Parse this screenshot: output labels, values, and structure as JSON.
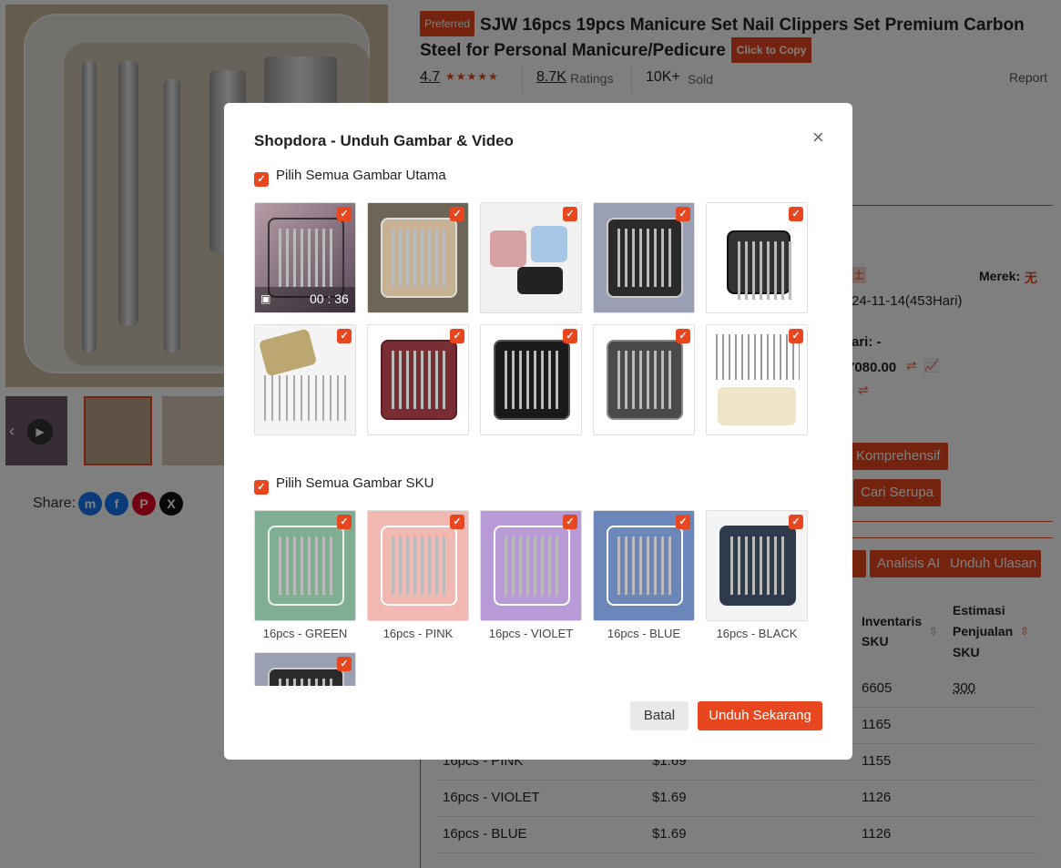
{
  "product": {
    "badge": "Preferred",
    "title": "SJW 16pcs 19pcs Manicure Set Nail Clippers Set Premium Carbon Steel for Personal Manicure/Pedicure",
    "copy_label": "Click to Copy",
    "rating": "4.7",
    "ratings_count": "8.7K",
    "ratings_label": "Ratings",
    "sold_count": "10K+",
    "sold_label": "Sold",
    "report_label": "Report"
  },
  "share": {
    "label": "Share:"
  },
  "panel": {
    "brand_label": "Merek:",
    "brand_value": "无",
    "date_text": "24-11-14(453Hari)",
    "hari_text": "ari: -",
    "price_text": "7080.00",
    "tag_char": "土",
    "btn_comprehensive": "Komprehensif",
    "btn_similar": "Cari Serupa"
  },
  "panel2": {
    "btn_ai": "Analisis AI",
    "btn_reviews": "Unduh Ulasan",
    "col_inventory": "Inventaris SKU",
    "col_estimate": "Estimasi Penjualan SKU",
    "rows": [
      {
        "name": "",
        "price": "",
        "inv": "6605",
        "est": "300"
      },
      {
        "name": "",
        "price": "",
        "inv": "1165",
        "est": ""
      },
      {
        "name": "16pcs - PINK",
        "price": "$1.69",
        "inv": "1155",
        "est": ""
      },
      {
        "name": "16pcs - VIOLET",
        "price": "$1.69",
        "inv": "1126",
        "est": ""
      },
      {
        "name": "16pcs - BLUE",
        "price": "$1.69",
        "inv": "1126",
        "est": ""
      }
    ]
  },
  "modal": {
    "title": "Shopdora - Unduh Gambar & Video",
    "select_main": "Pilih Semua Gambar Utama",
    "select_sku": "Pilih Semua Gambar SKU",
    "video_time": "00 : 36",
    "sku_captions": [
      "16pcs - GREEN",
      "16pcs - PINK",
      "16pcs - VIOLET",
      "16pcs - BLUE",
      "16pcs - BLACK"
    ],
    "sku_colors": [
      "#7fae92",
      "#f2b9b3",
      "#b79ad6",
      "#6b86b8",
      "#2f3a4c"
    ],
    "cancel_label": "Batal",
    "download_label": "Unduh Sekarang",
    "check_glyph": "✓"
  },
  "colors": {
    "accent": "#e8461e"
  }
}
